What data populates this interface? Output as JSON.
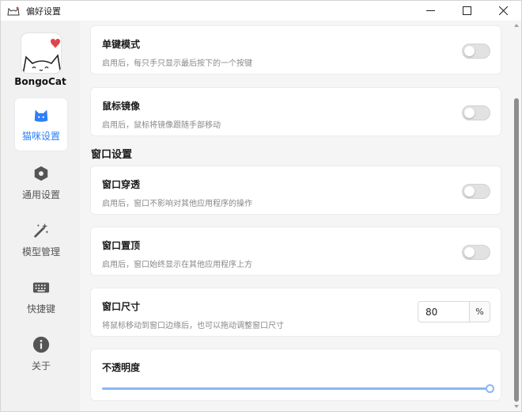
{
  "window": {
    "title": "偏好设置"
  },
  "sidebar": {
    "brand": "BongoCat",
    "items": [
      {
        "label": "猫咪设置",
        "icon": "cat-icon",
        "active": true
      },
      {
        "label": "通用设置",
        "icon": "settings-hex-icon",
        "active": false
      },
      {
        "label": "模型管理",
        "icon": "magic-wand-icon",
        "active": false
      },
      {
        "label": "快捷键",
        "icon": "keyboard-icon",
        "active": false
      },
      {
        "label": "关于",
        "icon": "info-icon",
        "active": false
      }
    ]
  },
  "settings": {
    "single_key": {
      "title": "单键模式",
      "desc": "启用后，每只手只显示最后按下的一个按键",
      "enabled": false
    },
    "mouse_mirror": {
      "title": "鼠标镜像",
      "desc": "启用后，鼠标将镜像跟随手部移动",
      "enabled": false
    },
    "window_section": "窗口设置",
    "pass_through": {
      "title": "窗口穿透",
      "desc": "启用后，窗口不影响对其他应用程序的操作",
      "enabled": false
    },
    "always_on_top": {
      "title": "窗口置顶",
      "desc": "启用后，窗口始终显示在其他应用程序上方",
      "enabled": false
    },
    "window_size": {
      "title": "窗口尺寸",
      "desc": "将鼠标移动到窗口边缘后，也可以拖动调整窗口尺寸",
      "value": "80",
      "unit": "%"
    },
    "opacity": {
      "title": "不透明度",
      "value_fraction": 1.0
    }
  },
  "colors": {
    "accent": "#2d7ff9",
    "slider": "#8bb8f2"
  }
}
